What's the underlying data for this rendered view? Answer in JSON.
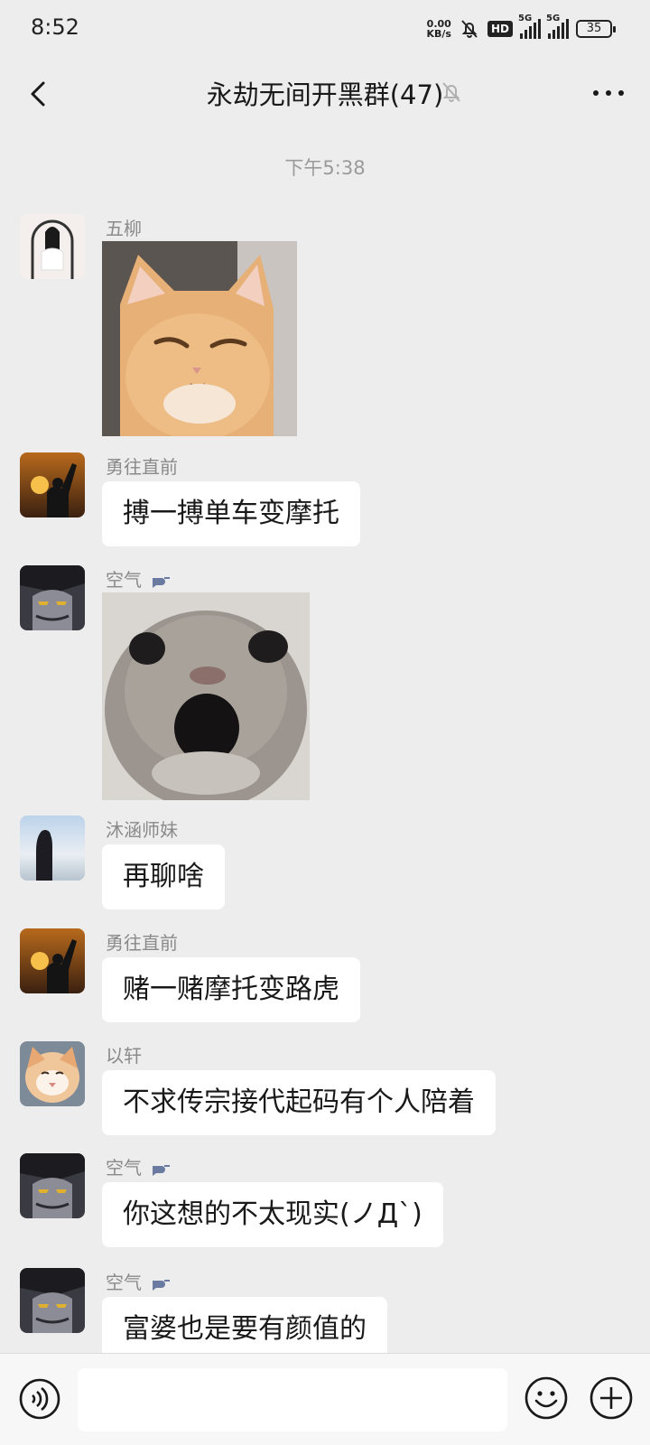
{
  "status_bar": {
    "time": "8:52",
    "net_speed_value": "0.00",
    "net_speed_unit": "KB/s",
    "hd_label": "HD",
    "sim1_label": "5G",
    "sim2_label": "5G",
    "battery": "35"
  },
  "header": {
    "title": "永劫无间开黑群(47)"
  },
  "chat": {
    "timestamp": "下午5:38",
    "messages": [
      {
        "sender": "五柳",
        "type": "sticker",
        "sticker": "orange-cat-squint"
      },
      {
        "sender": "勇往直前",
        "type": "text",
        "text": "搏一搏单车变摩托"
      },
      {
        "sender": "空气",
        "type": "sticker",
        "sticker": "gray-cat-shocked",
        "has_tag": true
      },
      {
        "sender": "沐涵师妹",
        "type": "text",
        "text": "再聊啥"
      },
      {
        "sender": "勇往直前",
        "type": "text",
        "text": "赌一赌摩托变路虎"
      },
      {
        "sender": "以轩",
        "type": "text",
        "text": "不求传宗接代起码有个人陪着"
      },
      {
        "sender": "空气",
        "type": "text",
        "text": "你这想的不太现实(ノД`)",
        "has_tag": true
      },
      {
        "sender": "空气",
        "type": "text",
        "text": "富婆也是要有颜值的",
        "has_tag": true
      }
    ]
  },
  "colors": {
    "background": "#ededed",
    "bubble": "#ffffff",
    "sender_text": "#8a8a8a",
    "input_bar": "#f7f7f7"
  },
  "icons": {
    "back": "chevron-left-icon",
    "mute": "bell-off-icon",
    "more": "more-dots-icon",
    "voice": "voice-icon",
    "emoji": "emoji-icon",
    "plus": "plus-icon"
  }
}
